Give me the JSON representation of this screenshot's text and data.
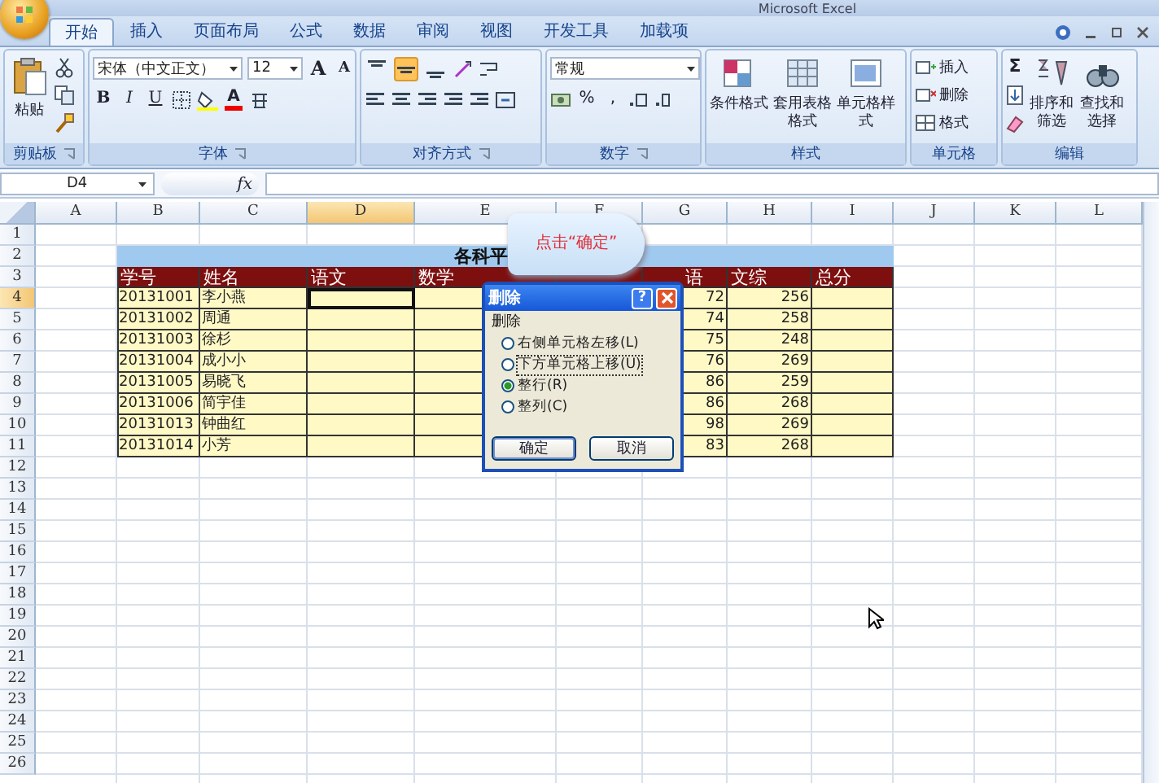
{
  "window": {
    "title": "Microsoft Excel"
  },
  "tabs": [
    {
      "label": "开始",
      "selected": true
    },
    {
      "label": "插入",
      "selected": false
    },
    {
      "label": "页面布局",
      "selected": false
    },
    {
      "label": "公式",
      "selected": false
    },
    {
      "label": "数据",
      "selected": false
    },
    {
      "label": "审阅",
      "selected": false
    },
    {
      "label": "视图",
      "selected": false
    },
    {
      "label": "开发工具",
      "selected": false
    },
    {
      "label": "加载项",
      "selected": false
    }
  ],
  "ribbon": {
    "groups": [
      {
        "kind": "clipboard",
        "label": "剪贴板",
        "paste": "粘贴"
      },
      {
        "kind": "font",
        "label": "字体",
        "font_name": "宋体（中文正文）",
        "font_size": "12",
        "grow": "A",
        "shrink": "A",
        "bold": "B",
        "italic": "I",
        "underline": "U",
        "font_color": "A"
      },
      {
        "kind": "align",
        "label": "对齐方式",
        "vertical": [
          {
            "selected": false
          },
          {
            "selected": true
          },
          {
            "selected": false
          }
        ]
      },
      {
        "kind": "number",
        "label": "数字",
        "format": "常规",
        "percent": "%",
        "comma": ","
      },
      {
        "kind": "styles",
        "label": "样式",
        "buttons": [
          "条件格式",
          "套用表格格式",
          "单元格样式"
        ]
      },
      {
        "kind": "cells",
        "label": "单元格",
        "items": [
          "插入",
          "删除",
          "格式"
        ]
      },
      {
        "kind": "edit",
        "label": "编辑",
        "sum": "Σ",
        "buttons": [
          "排序和筛选",
          "查找和选择"
        ]
      }
    ]
  },
  "formula_bar": {
    "name_box": "D4",
    "function_label": "fx"
  },
  "sheet": {
    "columns": [
      {
        "label": "A",
        "selected": false
      },
      {
        "label": "B",
        "selected": false
      },
      {
        "label": "C",
        "selected": false
      },
      {
        "label": "D",
        "selected": true
      },
      {
        "label": "E",
        "selected": false
      },
      {
        "label": "F",
        "selected": false
      },
      {
        "label": "G",
        "selected": false
      },
      {
        "label": "H",
        "selected": false
      },
      {
        "label": "I",
        "selected": false
      },
      {
        "label": "J",
        "selected": false
      },
      {
        "label": "K",
        "selected": false
      },
      {
        "label": "L",
        "selected": false
      }
    ],
    "rows": [
      {
        "label": "1",
        "selected": false
      },
      {
        "label": "2",
        "selected": false
      },
      {
        "label": "3",
        "selected": false
      },
      {
        "label": "4",
        "selected": true
      },
      {
        "label": "5",
        "selected": false
      },
      {
        "label": "6",
        "selected": false
      },
      {
        "label": "7",
        "selected": false
      },
      {
        "label": "8",
        "selected": false
      },
      {
        "label": "9",
        "selected": false
      },
      {
        "label": "10",
        "selected": false
      },
      {
        "label": "11",
        "selected": false
      },
      {
        "label": "12",
        "selected": false
      },
      {
        "label": "13",
        "selected": false
      },
      {
        "label": "14",
        "selected": false
      },
      {
        "label": "15",
        "selected": false
      },
      {
        "label": "16",
        "selected": false
      },
      {
        "label": "17",
        "selected": false
      },
      {
        "label": "18",
        "selected": false
      },
      {
        "label": "19",
        "selected": false
      },
      {
        "label": "20",
        "selected": false
      },
      {
        "label": "21",
        "selected": false
      },
      {
        "label": "22",
        "selected": false
      },
      {
        "label": "23",
        "selected": false
      },
      {
        "label": "24",
        "selected": false
      },
      {
        "label": "25",
        "selected": false
      },
      {
        "label": "26",
        "selected": false
      }
    ]
  },
  "table": {
    "title": "各科平",
    "headers": [
      "学号",
      "姓名",
      "语文",
      "数学",
      "语",
      "文综",
      "总分"
    ],
    "rows": [
      {
        "id": "20131001",
        "name": "李小燕",
        "english": "72",
        "liberal_arts": "256"
      },
      {
        "id": "20131002",
        "name": "周通",
        "english": "74",
        "liberal_arts": "258"
      },
      {
        "id": "20131003",
        "name": "徐杉",
        "english": "75",
        "liberal_arts": "248"
      },
      {
        "id": "20131004",
        "name": "成小小",
        "english": "76",
        "liberal_arts": "269"
      },
      {
        "id": "20131005",
        "name": "易晓飞",
        "english": "86",
        "liberal_arts": "259"
      },
      {
        "id": "20131006",
        "name": "简宇佳",
        "english": "86",
        "liberal_arts": "268"
      },
      {
        "id": "20131013",
        "name": "钟曲红",
        "english": "98",
        "liberal_arts": "269"
      },
      {
        "id": "20131014",
        "name": "小芳",
        "english": "83",
        "liberal_arts": "268"
      }
    ]
  },
  "dialog": {
    "title": "删除",
    "help": "?",
    "group": "删除",
    "options": [
      {
        "label": "右侧单元格左移(L)",
        "selected": false
      },
      {
        "label": "下方单元格上移(U)",
        "selected": false
      },
      {
        "label": "整行(R)",
        "selected": true
      },
      {
        "label": "整列(C)",
        "selected": false
      }
    ],
    "buttons": [
      "确定",
      "取消"
    ]
  },
  "callout": {
    "text": "点击“确定”"
  }
}
